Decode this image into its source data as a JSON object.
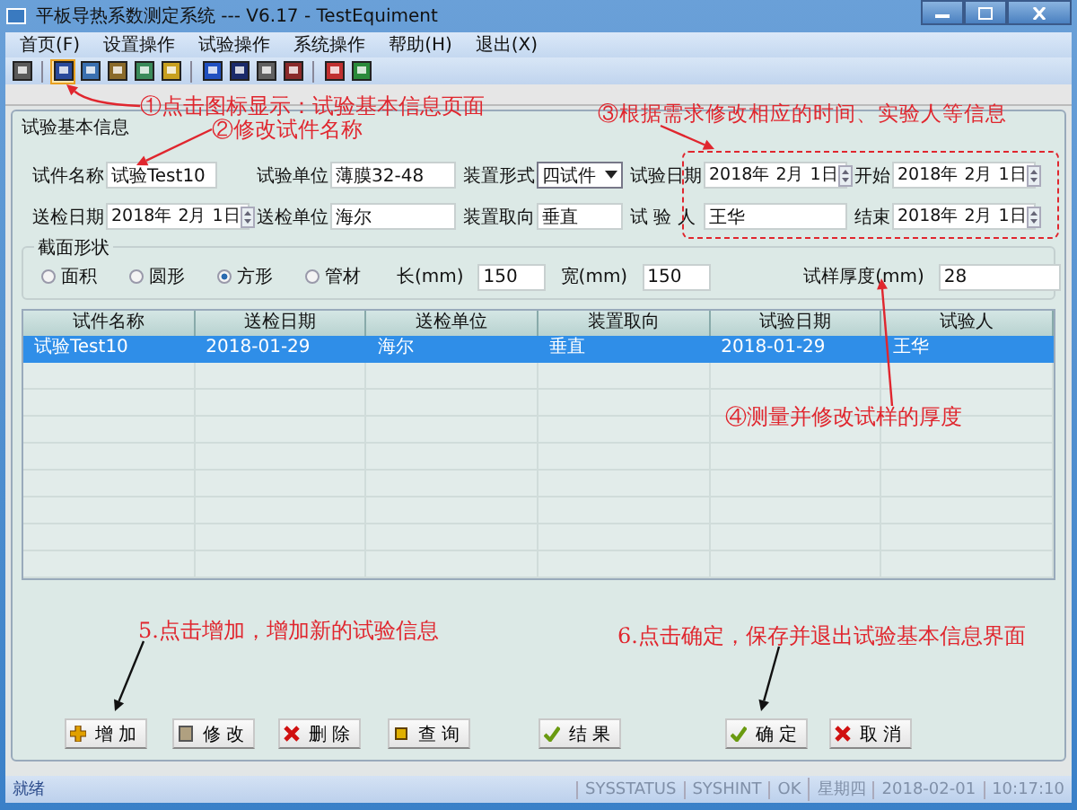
{
  "window": {
    "title": "平板导热系数测定系统 --- V6.17 - TestEquiment"
  },
  "menu": [
    "首页(F)",
    "设置操作",
    "试验操作",
    "系统操作",
    "帮助(H)",
    "退出(X)"
  ],
  "toolbar": [
    [
      {
        "selected": false
      }
    ],
    [
      {
        "selected": true
      },
      {
        "selected": false
      },
      {
        "selected": false
      },
      {
        "selected": false
      },
      {
        "selected": false
      }
    ],
    [
      {
        "selected": false
      },
      {
        "selected": false
      },
      {
        "selected": false
      },
      {
        "selected": false
      }
    ],
    [
      {
        "selected": false
      },
      {
        "selected": false
      }
    ]
  ],
  "annotations": [
    "①点击图标显示：试验基本信息页面",
    "②修改试件名称",
    "③根据需求修改相应的时间、实验人等信息",
    "④测量并修改试样的厚度",
    "5.点击增加，增加新的试验信息",
    "6.点击确定，保存并退出试验基本信息界面"
  ],
  "form": {
    "title": "试验基本信息",
    "rows": [
      [
        {
          "label": "试件名称",
          "value": "试验Test10",
          "kind": "text"
        },
        {
          "label": "试验单位",
          "value": "薄膜32-48",
          "kind": "text"
        },
        {
          "label": "装置形式",
          "value": "四试件",
          "kind": "select"
        },
        {
          "label": "试验日期",
          "value": "2018年 2月 1日",
          "kind": "date"
        },
        {
          "label": "开始",
          "value": "2018年 2月 1日",
          "kind": "date"
        }
      ],
      [
        {
          "label": "送检日期",
          "value": "2018年 2月 1日",
          "kind": "date"
        },
        {
          "label": "送检单位",
          "value": "海尔",
          "kind": "text"
        },
        {
          "label": "装置取向",
          "value": "垂直",
          "kind": "text"
        },
        {
          "label": "试 验 人",
          "value": "王华",
          "kind": "text"
        },
        {
          "label": "结束",
          "value": "2018年 2月 1日",
          "kind": "date"
        }
      ]
    ],
    "shape": {
      "title": "截面形状",
      "options": [
        {
          "label": "面积",
          "selected": false
        },
        {
          "label": "圆形",
          "selected": false
        },
        {
          "label": "方形",
          "selected": true
        },
        {
          "label": "管材",
          "selected": false
        }
      ],
      "measures": [
        {
          "label": "长(mm)",
          "value": "150"
        },
        {
          "label": "宽(mm)",
          "value": "150"
        },
        {
          "label": "试样厚度(mm)",
          "value": "28"
        }
      ]
    }
  },
  "table": {
    "columns": [
      "试件名称",
      "送检日期",
      "送检单位",
      "装置取向",
      "试验日期",
      "试验人"
    ],
    "rows": [
      {
        "cells": [
          "试验Test10",
          "2018-01-29",
          "海尔",
          "垂直",
          "2018-01-29",
          "王华"
        ],
        "selected": true
      }
    ]
  },
  "buttons": [
    {
      "label": "增加",
      "kind": "add"
    },
    {
      "label": "修改",
      "kind": "edit"
    },
    {
      "label": "删除",
      "kind": "delete"
    },
    {
      "label": "查询",
      "kind": "query"
    },
    {
      "label": "结果",
      "kind": "result"
    },
    {
      "label": "确定",
      "kind": "confirm"
    },
    {
      "label": "取消",
      "kind": "cancel"
    }
  ],
  "status_bar": [
    "就绪",
    "SYSSTATUS",
    "SYSHINT",
    "OK",
    "星期四",
    "2018-02-01",
    "10:17:10"
  ]
}
